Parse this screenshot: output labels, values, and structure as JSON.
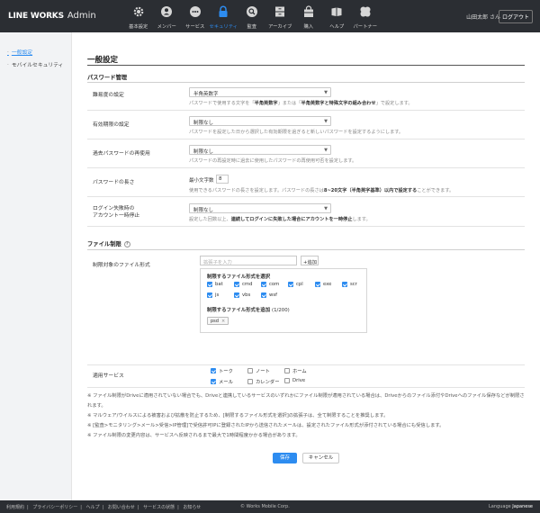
{
  "header": {
    "logo": "LINE WORKS",
    "admin": "Admin",
    "nav": [
      {
        "label": "基本設定",
        "icon": "gear-icon"
      },
      {
        "label": "メンバー",
        "icon": "member-icon"
      },
      {
        "label": "サービス",
        "icon": "service-icon"
      },
      {
        "label": "セキュリティ",
        "icon": "lock-icon",
        "active": true
      },
      {
        "label": "監査",
        "icon": "audit-icon"
      },
      {
        "label": "アーカイブ",
        "icon": "archive-icon"
      },
      {
        "label": "購入",
        "icon": "purchase-icon"
      },
      {
        "label": "ヘルプ",
        "icon": "help-icon"
      },
      {
        "label": "パートナー",
        "icon": "partner-icon"
      }
    ],
    "user": "山田太郎 さん",
    "logout": "ログアウト"
  },
  "sidebar": {
    "items": [
      {
        "label": "一般設定",
        "active": true
      },
      {
        "label": "モバイルセキュリティ",
        "active": false
      }
    ]
  },
  "main": {
    "title": "一般設定",
    "password_section": "パスワード管理",
    "rows": {
      "complexity": {
        "label": "難易度の設定",
        "value": "半角英数字",
        "help_prefix": "パスワードで使用する文字を「",
        "help_b1": "半角英数字",
        "help_mid": "」または「",
        "help_b2": "半角英数字と特殊文字の組み合わせ",
        "help_suffix": "」で設定します。"
      },
      "expiry": {
        "label": "有効期限の設定",
        "value": "制限なし",
        "help": "パスワードを設定した日から選択した有効期限を過ぎると新しいパスワードを設定するようにします。"
      },
      "reuse": {
        "label": "過去パスワードの再使用",
        "value": "制限なし",
        "help": "パスワードの再設定時に過去に使用したパスワードの再使用可否を設定します。"
      },
      "length": {
        "label": "パスワードの長さ",
        "inline_label": "最小文字数",
        "value": "8",
        "help_prefix": "使用できるパスワードの長さを設定します。パスワードの長さは",
        "help_b": "8~20文字（半角英字基準）以内で設定する",
        "help_suffix": "ことができます。"
      },
      "lock": {
        "label_line1": "ログイン失敗時の",
        "label_line2": "アカウント一時停止",
        "value": "制限なし",
        "help_prefix": "設定した回数以上、",
        "help_b": "連続してログインに失敗した場合にアカウントを一時停止",
        "help_suffix": "します。"
      }
    },
    "file_section": "ファイル制限",
    "file_help_icon": "?",
    "file_target_label": "制限対象のファイル形式",
    "ext_placeholder": "拡張子を入力",
    "add_button": "+追加",
    "restricted_title": "制限するファイル形式を選択",
    "extensions": [
      {
        "label": "bat",
        "checked": true
      },
      {
        "label": "cmd",
        "checked": true
      },
      {
        "label": "com",
        "checked": true
      },
      {
        "label": "cpl",
        "checked": true
      },
      {
        "label": "exe",
        "checked": true
      },
      {
        "label": "scr",
        "checked": true
      },
      {
        "label": "js",
        "checked": true
      },
      {
        "label": "vbs",
        "checked": true
      },
      {
        "label": "wsf",
        "checked": true
      }
    ],
    "added_title": "制限するファイル形式を追加",
    "added_count": "(1/200)",
    "added_tags": [
      "psd"
    ],
    "services_label": "適用サービス",
    "services": [
      {
        "label": "トーク",
        "checked": true
      },
      {
        "label": "ノート",
        "checked": false
      },
      {
        "label": "ホーム",
        "checked": false
      },
      {
        "label": "メール",
        "checked": true
      },
      {
        "label": "カレンダー",
        "checked": false
      },
      {
        "label": "Drive",
        "checked": false
      }
    ],
    "notes": [
      "※ ファイル制限がDriveに適用されていない場合でも、Driveと連携しているサービスのいずれかにファイル制限が適用されている場合は、Driveからのファイル添付やDriveへのファイル保存などが制限されます。",
      "※ マルウェア/ウイルスによる被害および拡散を防止するため、[制限するファイル形式を選択]の拡張子は、全て制限することを推奨します。",
      "※ [監査>モニタリング>メール>受信>IP管理]で受信許可IPに登録されたIPから送信されたメールは、設定されたファイル形式が添付されている場合にも受信します。",
      "※ ファイル制限の変更内容は、サービスへ反映されるまで最大で1時間程度かかる場合があります。"
    ],
    "save": "保存",
    "cancel": "キャンセル"
  },
  "footer": {
    "links": [
      "利用規約",
      "プライバシーポリシー",
      "ヘルプ",
      "お問い合わせ",
      "サービスの状態",
      "お知らせ"
    ],
    "copyright": "© Works Mobile Corp.",
    "language_label": "Language",
    "language_value": "Japanese"
  },
  "colors": {
    "header_bg": "#2b2e33",
    "accent": "#2d8cf0"
  }
}
